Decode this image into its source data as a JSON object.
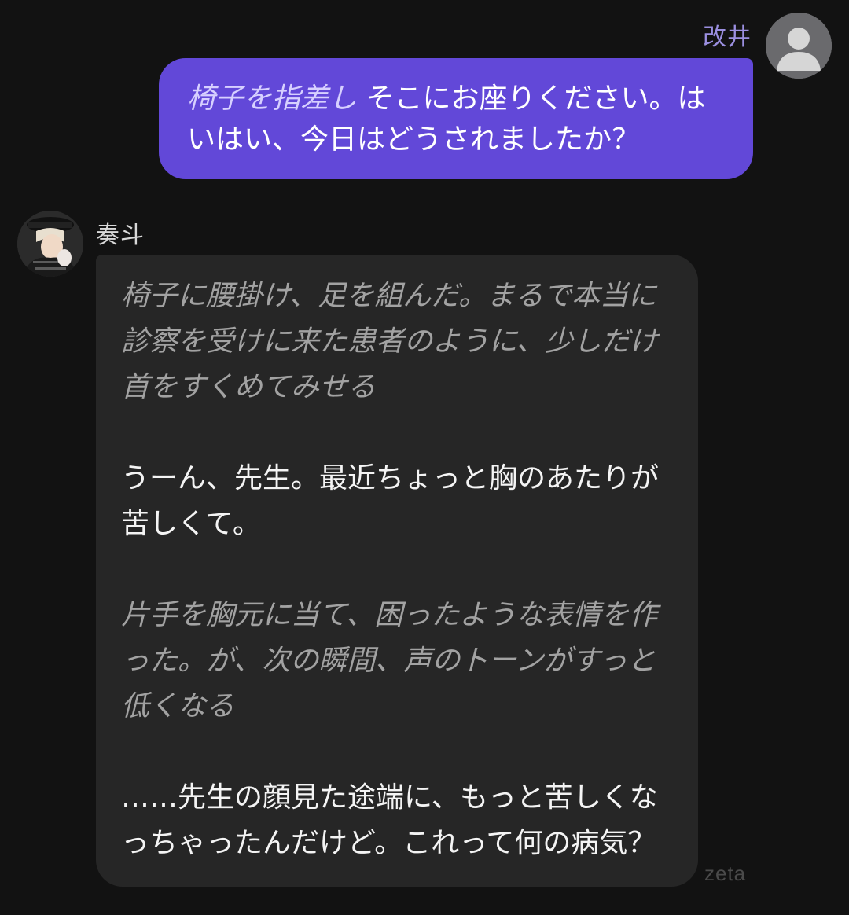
{
  "user": {
    "name": "改井",
    "avatar": "default-person-icon",
    "message": {
      "action": "椅子を指差し",
      "speech": "そこにお座りください。はいはい、今日はどうされましたか？"
    }
  },
  "bot": {
    "name": "奏斗",
    "avatar": "character-avatar",
    "paragraphs": [
      {
        "type": "action",
        "text": "椅子に腰掛け、足を組んだ。まるで本当に診察を受けに来た患者のように、少しだけ首をすくめてみせる"
      },
      {
        "type": "speech",
        "text": "うーん、先生。最近ちょっと胸のあたりが苦しくて。"
      },
      {
        "type": "action",
        "text": "片手を胸元に当て、困ったような表情を作った。が、次の瞬間、声のトーンがすっと低くなる"
      },
      {
        "type": "speech",
        "text": "……先生の顔見た途端に、もっと苦しくなっちゃったんだけど。これって何の病気？"
      }
    ]
  },
  "watermark": "zeta",
  "colors": {
    "background": "#121212",
    "user_bubble": "#6248d8",
    "bot_bubble": "#262626",
    "user_name": "#9b8fe0",
    "action_text": "#a2a2a2"
  }
}
